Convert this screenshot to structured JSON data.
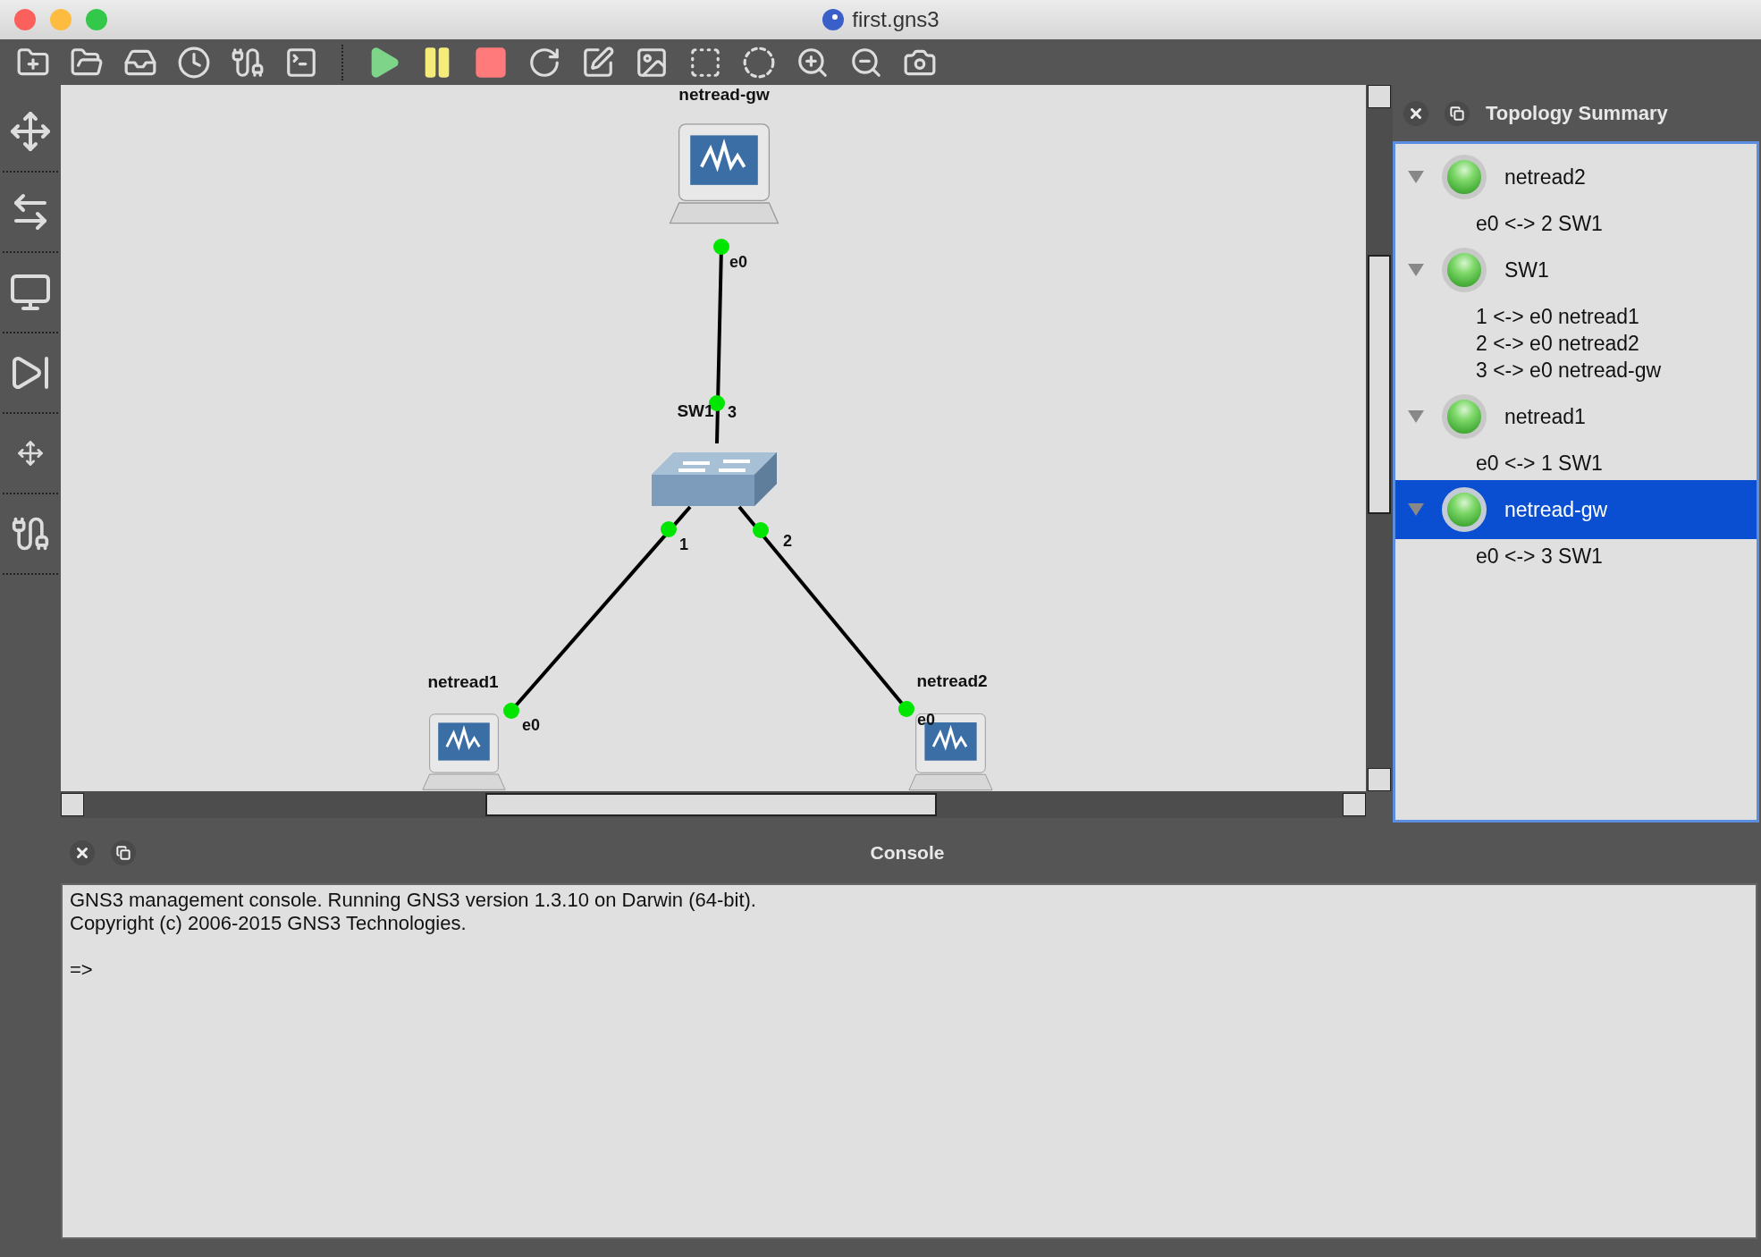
{
  "window": {
    "title": "first.gns3"
  },
  "canvas": {
    "nodes": [
      {
        "label": "netread-gw",
        "kind": "computer"
      },
      {
        "label": "SW1",
        "kind": "switch"
      },
      {
        "label": "netread1",
        "kind": "computer"
      },
      {
        "label": "netread2",
        "kind": "computer"
      }
    ],
    "links": [
      {
        "from_port": "e0",
        "to_port": "3"
      },
      {
        "from_port": "1",
        "to_port": "e0"
      },
      {
        "from_port": "2",
        "to_port": "e0"
      }
    ]
  },
  "topology_summary": {
    "title": "Topology Summary",
    "items": [
      {
        "name": "netread2",
        "started": true,
        "expanded": true,
        "selected": false,
        "children": [
          "e0 <-> 2 SW1"
        ]
      },
      {
        "name": "SW1",
        "started": true,
        "expanded": true,
        "selected": false,
        "children": [
          "1 <-> e0 netread1",
          "2 <-> e0 netread2",
          "3 <-> e0 netread-gw"
        ]
      },
      {
        "name": "netread1",
        "started": true,
        "expanded": true,
        "selected": false,
        "children": [
          "e0 <-> 1 SW1"
        ]
      },
      {
        "name": "netread-gw",
        "started": true,
        "expanded": true,
        "selected": true,
        "children": [
          "e0 <-> 3 SW1"
        ]
      }
    ]
  },
  "console": {
    "title": "Console",
    "lines": [
      "GNS3 management console. Running GNS3 version 1.3.10 on Darwin (64-bit).",
      "Copyright (c) 2006-2015 GNS3 Technologies."
    ],
    "prompt": "=>"
  }
}
